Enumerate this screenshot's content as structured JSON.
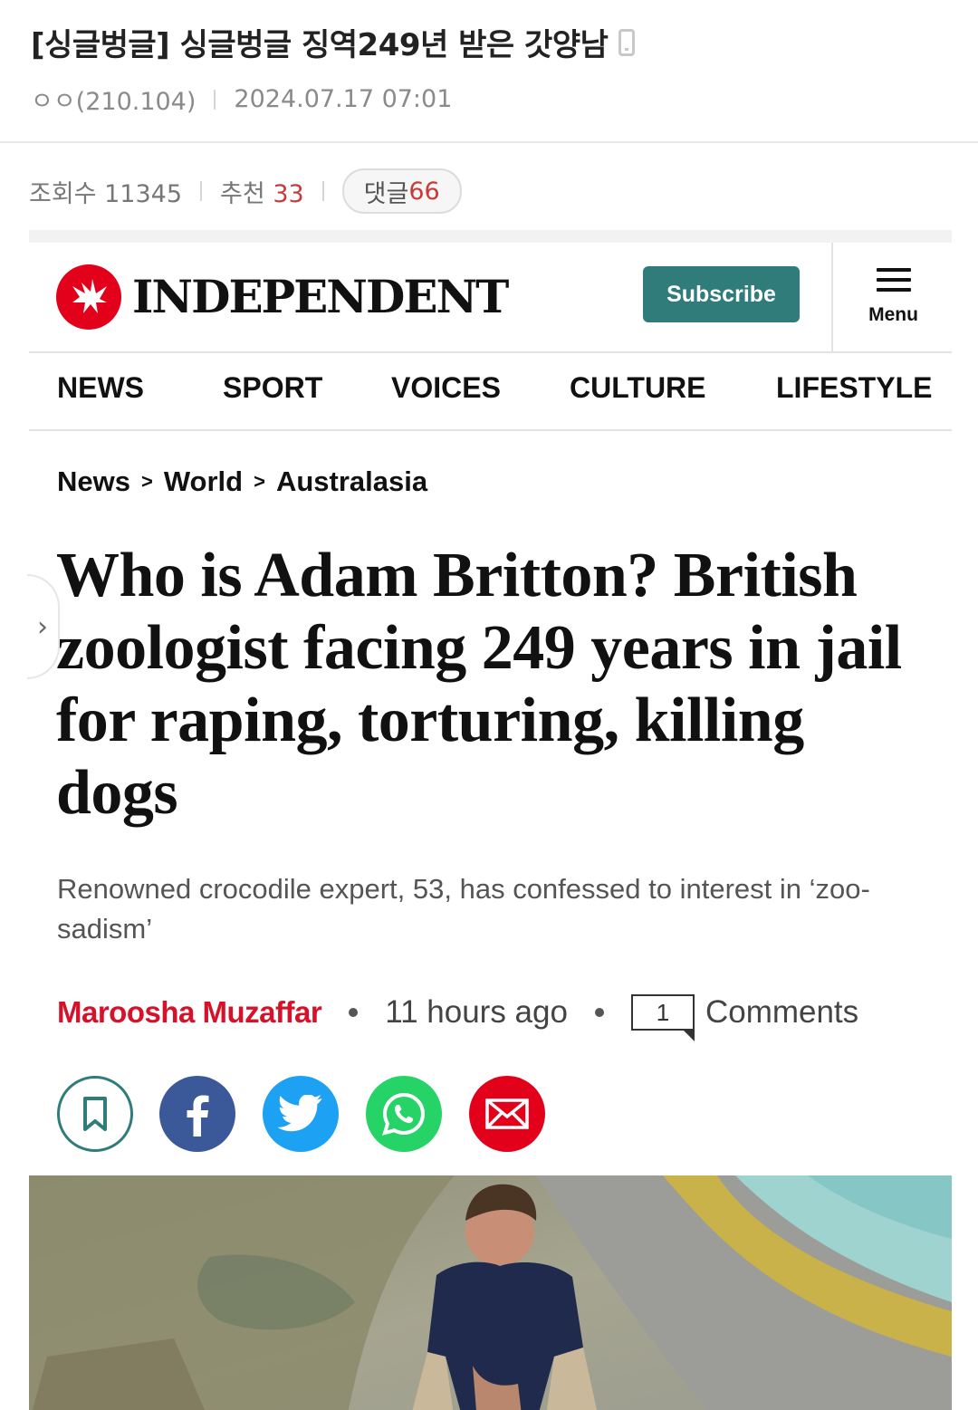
{
  "post": {
    "title": "[싱글벙글] 싱글벙글 징역249년 받은 갓양남",
    "author": "ㅇㅇ(210.104)",
    "date": "2024.07.17 07:01",
    "views_label": "조회수",
    "views": "11345",
    "recommend_label": "추천",
    "recommend": "33",
    "comments_label": "댓글",
    "comments": "66"
  },
  "site": {
    "logo_text": "INDEPENDENT",
    "subscribe_label": "Subscribe",
    "menu_label": "Menu",
    "brand_color": "#e3001b",
    "accent_color": "#2f7c7a"
  },
  "nav": {
    "items": [
      "NEWS",
      "SPORT",
      "VOICES",
      "CULTURE",
      "LIFESTYLE"
    ]
  },
  "breadcrumb": [
    "News",
    ">",
    "World",
    ">",
    "Australasia"
  ],
  "article": {
    "headline": "Who is Adam Britton? British zoologist facing 249 years in jail for raping, torturing, killing dogs",
    "standfirst": "Renowned crocodile expert, 53, has confessed to interest in ‘zoo-sadism’",
    "author": "Maroosha Muzaffar",
    "time": "11 hours ago",
    "comment_count": "1",
    "comments_label": "Comments"
  },
  "share": {
    "icons": [
      "bookmark-icon",
      "facebook-icon",
      "twitter-icon",
      "whatsapp-icon",
      "email-icon"
    ],
    "colors": {
      "bookmark": "#2f7c7a",
      "facebook": "#3b5998",
      "twitter": "#1da1f2",
      "whatsapp": "#25d366",
      "email": "#e3001b"
    }
  }
}
